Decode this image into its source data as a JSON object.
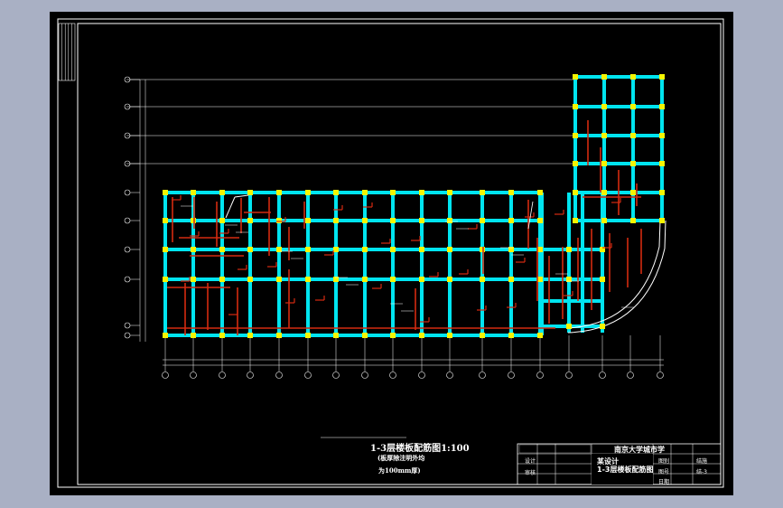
{
  "drawing": {
    "title": "1-3层楼板配筋图1:100",
    "note_line1": "(板厚除注明外均",
    "note_line2": "为100mm厚)",
    "colors": {
      "page_bg": "#a9b0c4",
      "sheet_bg": "#000000",
      "frame": "#ffffff",
      "beam": "#00e5f0",
      "column": "#f5f500",
      "rebar": "#d42a10",
      "dimension": "#ffffff"
    }
  },
  "title_block": {
    "school": "南京大学城市学",
    "project": "某设计",
    "drawing_name": "1-3层楼板配筋图",
    "labels": {
      "design": "设计",
      "check": "审核",
      "drawing_type": "图别",
      "drawing_no": "图号",
      "date": "日期"
    },
    "values": {
      "drawing_type": "结施",
      "drawing_no": "结-3"
    }
  }
}
